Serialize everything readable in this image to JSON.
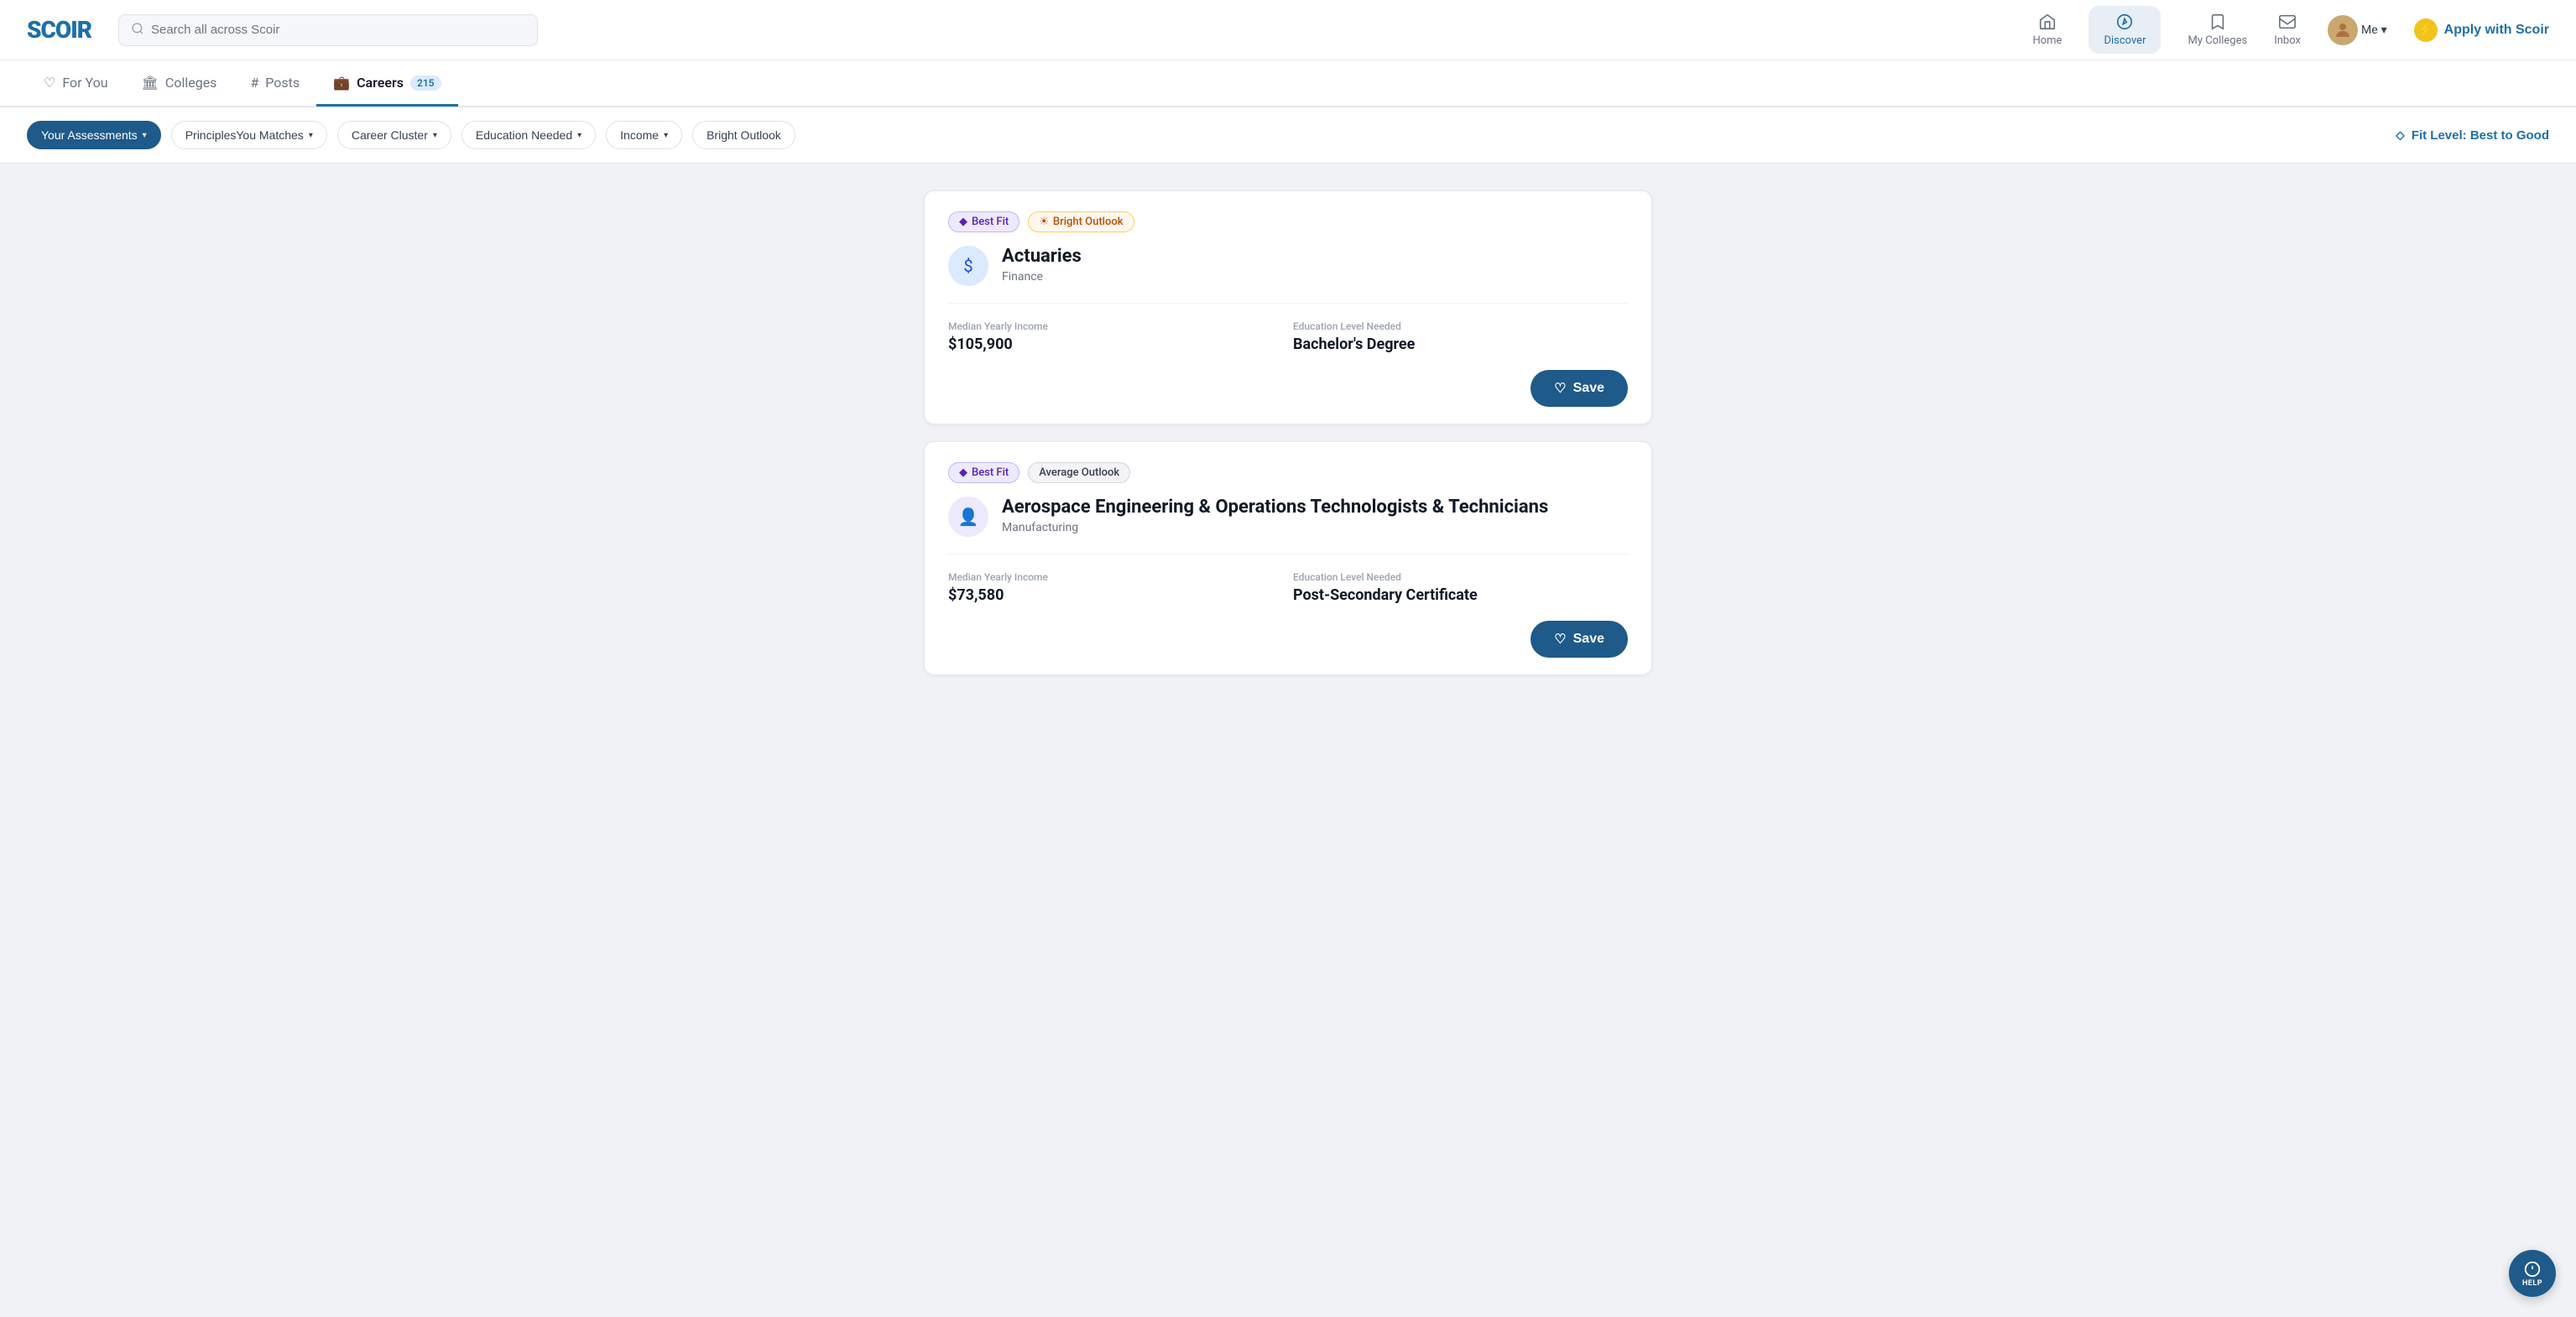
{
  "app": {
    "logo": "SCOIR",
    "search_placeholder": "Search all across Scoir"
  },
  "header": {
    "nav_items": [
      {
        "id": "home",
        "label": "Home",
        "active": false
      },
      {
        "id": "discover",
        "label": "Discover",
        "active": true
      },
      {
        "id": "my_colleges",
        "label": "My Colleges",
        "active": false
      },
      {
        "id": "inbox",
        "label": "Inbox",
        "active": false
      }
    ],
    "me_label": "Me",
    "apply_label": "Apply with Scoir"
  },
  "tabs": [
    {
      "id": "for_you",
      "label": "For You",
      "active": false,
      "badge": null
    },
    {
      "id": "colleges",
      "label": "Colleges",
      "active": false,
      "badge": null
    },
    {
      "id": "posts",
      "label": "Posts",
      "active": false,
      "badge": null
    },
    {
      "id": "careers",
      "label": "Careers",
      "active": true,
      "badge": "215"
    }
  ],
  "filters": {
    "your_assessments": "Your Assessments",
    "principles_you_matches": "PrinciplesYou Matches",
    "career_cluster": "Career Cluster",
    "education_needed": "Education Needed",
    "income": "Income",
    "bright_outlook": "Bright Outlook",
    "fit_level": "Fit Level: Best to Good"
  },
  "careers": [
    {
      "id": "actuaries",
      "badge_fit": "Best Fit",
      "badge_outlook": "Bright Outlook",
      "badge_outlook_type": "bright",
      "title": "Actuaries",
      "cluster": "Finance",
      "icon": "$",
      "icon_style": "finance",
      "income_label": "Median Yearly Income",
      "income_value": "$105,900",
      "education_label": "Education Level Needed",
      "education_value": "Bachelor's Degree",
      "save_label": "Save"
    },
    {
      "id": "aerospace",
      "badge_fit": "Best Fit",
      "badge_outlook": "Average Outlook",
      "badge_outlook_type": "average",
      "title": "Aerospace Engineering & Operations Technologists & Technicians",
      "cluster": "Manufacturing",
      "icon": "👤",
      "icon_style": "manufacturing",
      "income_label": "Median Yearly Income",
      "income_value": "$73,580",
      "education_label": "Education Level Needed",
      "education_value": "Post-Secondary Certificate",
      "save_label": "Save"
    }
  ],
  "help": {
    "label": "HELP"
  }
}
